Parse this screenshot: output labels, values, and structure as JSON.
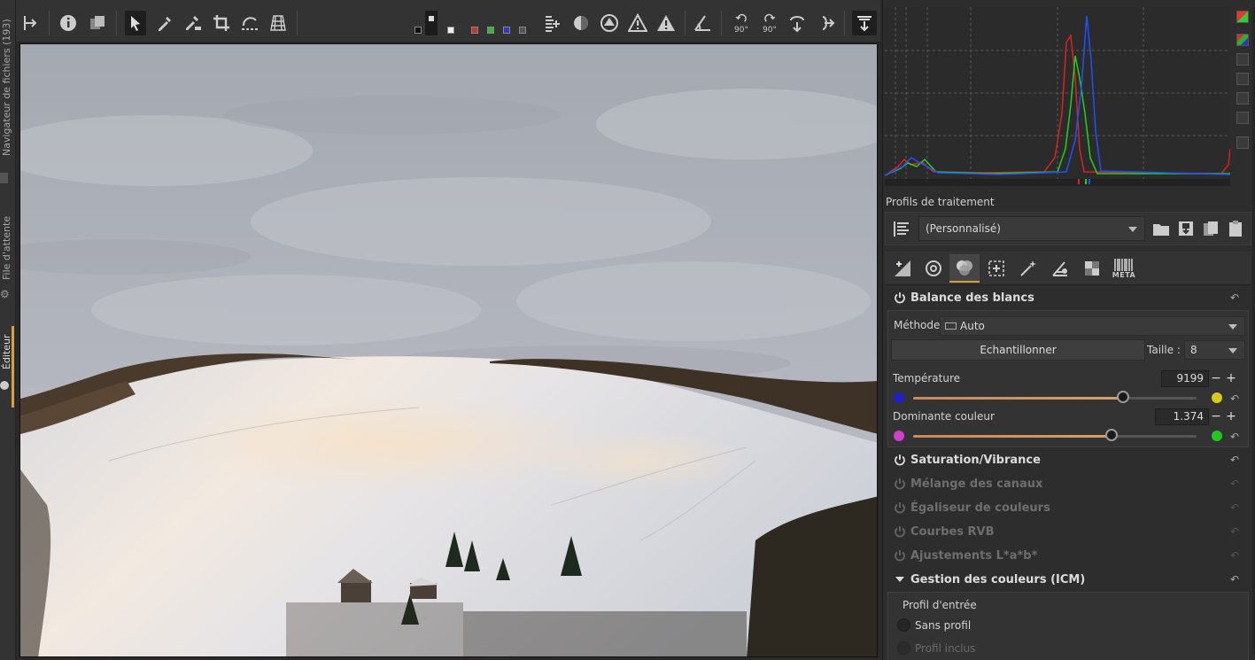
{
  "left_strip": {
    "nav_label": "Navigateur de fichiers (193)",
    "filmstrip_label": "File d'attente",
    "editor_label": "Éditeur"
  },
  "toolbar": {
    "icons": [
      "side-panel-toggle-icon",
      "info-icon",
      "before-after-icon",
      "hand-tool-icon",
      "color-picker-icon",
      "white-balance-picker-icon",
      "crop-icon",
      "straighten-icon",
      "perspective-icon",
      "preview-channels-icon",
      "histogram-raw-icon",
      "focus-mask-icon",
      "shadow-clip-icon",
      "highlight-clip-icon",
      "warning-clip-icon",
      "rotate-ccw-icon",
      "rotate-cw-icon",
      "flip-vertical-icon",
      "flip-horizontal-icon",
      "panel-toggle-icon"
    ],
    "rotate_left_label": "90°",
    "rotate_right_label": "90°"
  },
  "histogram": {
    "colors": {
      "red": "#e02020",
      "green": "#20d020",
      "blue": "#2050ff"
    }
  },
  "profiles": {
    "label": "Profils de traitement",
    "selected": "(Personnalisé)"
  },
  "tool_tabs": [
    "exposure-tab",
    "details-tab",
    "color-tab",
    "local-tab",
    "transform-tab",
    "raw-tab",
    "advanced-tab",
    "metadata-tab"
  ],
  "tabs_meta_label": "META",
  "sections": {
    "white_balance": "Balance des blancs",
    "saturation": "Saturation/Vibrance",
    "channel_mixer": "Mélange des canaux",
    "color_equalizer": "Égaliseur de couleurs",
    "rgb_curves": "Courbes RVB",
    "lab_adjust": "Ajustements L*a*b*",
    "icm": "Gestion des couleurs (ICM)"
  },
  "white_balance": {
    "method_label": "Méthode:",
    "method_value": "Auto",
    "sample_button": "Echantillonner",
    "size_label": "Taille :",
    "size_value": "8",
    "temperature_label": "Température",
    "temperature_value": "9199",
    "temperature_fraction": 0.74,
    "tint_label": "Dominante couleur",
    "tint_value": "1.374",
    "tint_fraction": 0.7
  },
  "icm": {
    "input_profile_label": "Profil d'entrée",
    "option_none": "Sans profil",
    "option_embedded": "Profil inclus"
  }
}
